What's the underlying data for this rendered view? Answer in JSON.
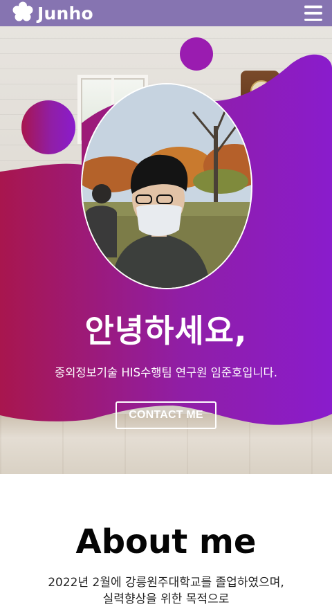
{
  "navbar": {
    "brand_name": "Junho",
    "brand_icon": "flower-icon",
    "menu_icon": "hamburger-menu-icon"
  },
  "hero": {
    "greeting": "안녕하세요,",
    "subtitle": "중외정보기술 HIS수행팀 연구원 임준호입니다.",
    "contact_label": "CONTACT ME",
    "colors": {
      "gradient_start": "#a8164e",
      "gradient_end": "#8a1ccc",
      "navbar": "#7c68aa"
    }
  },
  "about": {
    "title": "About me",
    "lines": [
      "2022년 2월에 강릉원주대학교를 졸업하였으며,",
      "실력향상을 위한 목적으로"
    ]
  }
}
